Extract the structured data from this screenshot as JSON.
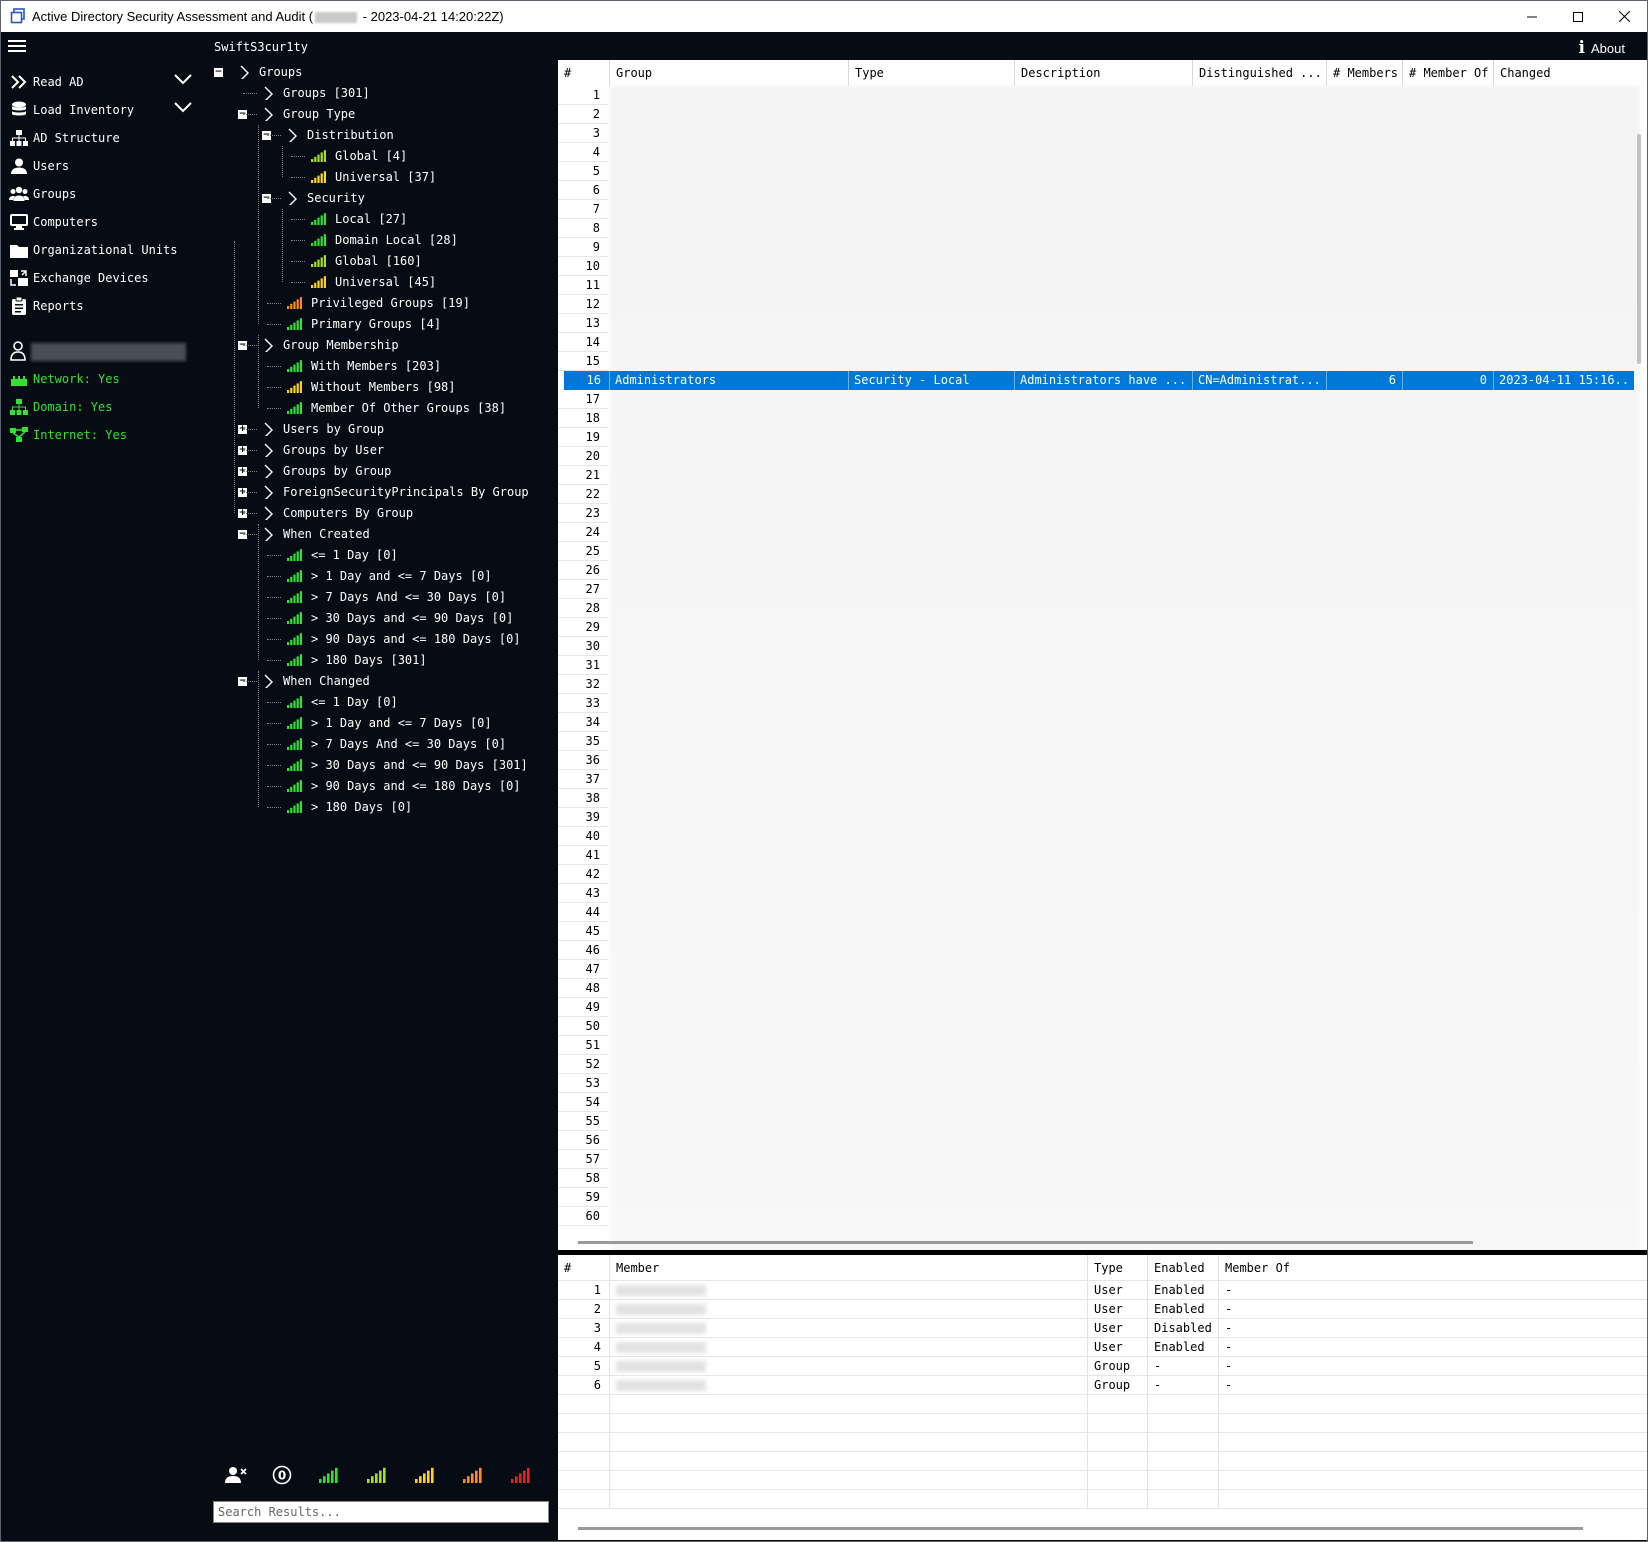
{
  "window": {
    "title_prefix": "Active Directory Security Assessment and Audit (",
    "title_suffix": " - 2023-04-21 14:20:22Z)"
  },
  "menubar": {
    "brand": "SwiftS3cur1ty",
    "about_label": "About"
  },
  "sidebar": {
    "items": [
      {
        "label": "Read AD",
        "icon": "double-chevron-icon"
      },
      {
        "label": "Load Inventory",
        "icon": "database-icon"
      },
      {
        "label": "AD Structure",
        "icon": "hierarchy-icon"
      },
      {
        "label": "Users",
        "icon": "user-icon"
      },
      {
        "label": "Groups",
        "icon": "users-group-icon"
      },
      {
        "label": "Computers",
        "icon": "monitor-icon"
      },
      {
        "label": "Organizational Units",
        "icon": "folder-icon"
      },
      {
        "label": "Exchange Devices",
        "icon": "exchange-icon"
      },
      {
        "label": "Reports",
        "icon": "clipboard-icon"
      }
    ],
    "status": {
      "network": "Network: Yes",
      "domain": "Domain: Yes",
      "internet": "Internet: Yes"
    },
    "status_color": "#32e132"
  },
  "tree": {
    "nodes": [
      "Groups",
      "Groups [301]",
      "Group Type",
      "Distribution",
      "Global [4]",
      "Universal [37]",
      "Security",
      "Local [27]",
      "Domain Local [28]",
      "Global [160]",
      "Universal [45]",
      "Privileged Groups [19]",
      "Primary Groups [4]",
      "Group Membership",
      "With Members [203]",
      "Without Members [98]",
      "Member Of Other Groups [38]",
      "Users by Group",
      "Groups by User",
      "Groups by Group",
      "ForeignSecurityPrincipals By Group",
      "Computers By Group",
      "When Created",
      "<= 1 Day [0]",
      "> 1 Day and <= 7 Days [0]",
      "> 7 Days And <= 30 Days [0]",
      "> 30 Days and <= 90 Days [0]",
      "> 90 Days and <= 180 Days [0]",
      "> 180 Days [301]",
      "When Changed",
      "<= 1 Day [0]",
      "> 1 Day and <= 7 Days [0]",
      "> 7 Days And <= 30 Days [0]",
      "> 30 Days and <= 90 Days [301]",
      "> 90 Days and <= 180 Days [0]",
      "> 180 Days [0]"
    ],
    "search_placeholder": "Search Results..."
  },
  "groups_grid": {
    "columns": [
      "#",
      "Group",
      "Type",
      "Description",
      "Distinguished ...",
      "# Members",
      "# Member Of",
      "Changed"
    ],
    "row_numbers": [
      "1",
      "2",
      "3",
      "4",
      "5",
      "6",
      "7",
      "8",
      "9",
      "10",
      "11",
      "12",
      "13",
      "14",
      "15",
      "16",
      "17",
      "18",
      "19",
      "20",
      "21",
      "22",
      "23",
      "24",
      "25",
      "26",
      "27",
      "28",
      "29",
      "30",
      "31",
      "32",
      "33",
      "34",
      "35",
      "36",
      "37",
      "38",
      "39",
      "40",
      "41",
      "42",
      "43",
      "44",
      "45",
      "46",
      "47",
      "48",
      "49",
      "50",
      "51",
      "52",
      "53",
      "54",
      "55",
      "56",
      "57",
      "58",
      "59",
      "60"
    ],
    "selected_row": {
      "num": "16",
      "group": "Administrators",
      "type": "Security - Local",
      "description": "Administrators have ...",
      "dn": "CN=Administrat...",
      "members": "6",
      "member_of": "0",
      "changed": "2023-04-11 15:16..."
    },
    "selection_color": "#0078d7"
  },
  "members_grid": {
    "columns": [
      "#",
      "Member",
      "Type",
      "Enabled",
      "Member Of"
    ],
    "rows": [
      {
        "num": "1",
        "type": "User",
        "enabled": "Enabled",
        "member_of": "-"
      },
      {
        "num": "2",
        "type": "User",
        "enabled": "Enabled",
        "member_of": "-"
      },
      {
        "num": "3",
        "type": "User",
        "enabled": "Disabled",
        "member_of": "-"
      },
      {
        "num": "4",
        "type": "User",
        "enabled": "Enabled",
        "member_of": "-"
      },
      {
        "num": "5",
        "type": "Group",
        "enabled": "-",
        "member_of": "-"
      },
      {
        "num": "6",
        "type": "Group",
        "enabled": "-",
        "member_of": "-"
      }
    ]
  },
  "legend": {
    "zero_label": "0",
    "colors": [
      "#32e132",
      "#a8e01e",
      "#ffd21e",
      "#ff8a1e",
      "#e82020"
    ]
  }
}
